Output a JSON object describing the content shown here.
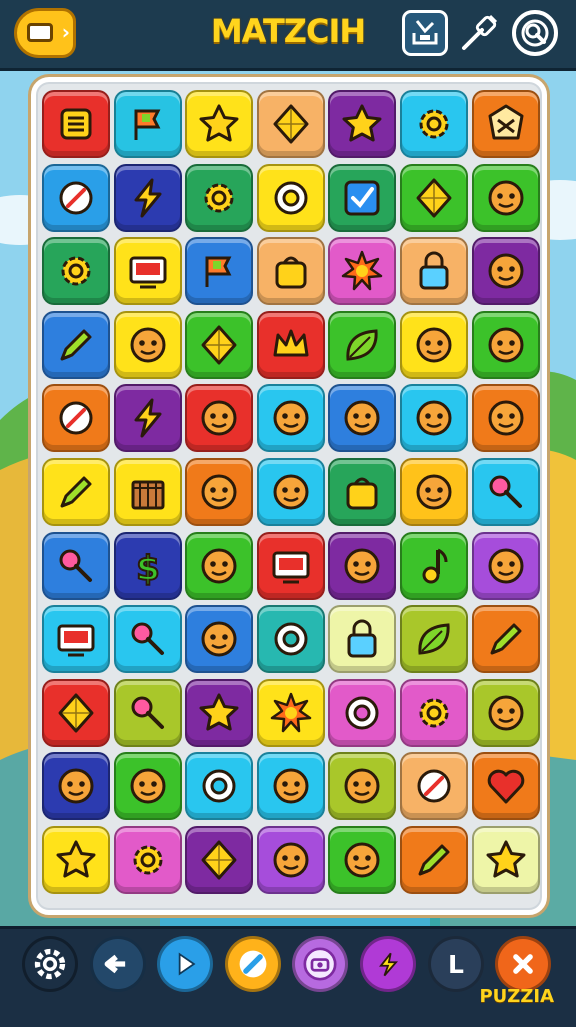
{
  "header": {
    "title": "MATZCIH"
  },
  "brand": "PUZZIA",
  "toolbar": {
    "menu_icon": "menu-icon",
    "tools": [
      "download-tray-icon",
      "wand-icon",
      "search-refresh-icon"
    ]
  },
  "board": {
    "rows": 11,
    "cols": 7,
    "tiles": [
      [
        {
          "c": "#e8302b",
          "i": "menu"
        },
        {
          "c": "#27c3e3",
          "i": "flag"
        },
        {
          "c": "#ffe21a",
          "i": "star"
        },
        {
          "c": "#f7b266",
          "i": "gem"
        },
        {
          "c": "#7e2aa1",
          "i": "star"
        },
        {
          "c": "#29c6ef",
          "i": "gear"
        },
        {
          "c": "#f07a1a",
          "i": "badge"
        }
      ],
      [
        {
          "c": "#2a9fe8",
          "i": "compass"
        },
        {
          "c": "#2c3bb0",
          "i": "bolt"
        },
        {
          "c": "#27a55a",
          "i": "gear"
        },
        {
          "c": "#ffe21a",
          "i": "ring"
        },
        {
          "c": "#27a55a",
          "i": "check"
        },
        {
          "c": "#3cc22a",
          "i": "gem"
        },
        {
          "c": "#3cc22a",
          "i": "face"
        }
      ],
      [
        {
          "c": "#27a55a",
          "i": "gear"
        },
        {
          "c": "#ffe21a",
          "i": "screen"
        },
        {
          "c": "#2e7fde",
          "i": "flag"
        },
        {
          "c": "#f7b266",
          "i": "bag"
        },
        {
          "c": "#e25ac9",
          "i": "sun"
        },
        {
          "c": "#f7b266",
          "i": "lock"
        },
        {
          "c": "#7e2aa1",
          "i": "face"
        }
      ],
      [
        {
          "c": "#2e7fde",
          "i": "pen"
        },
        {
          "c": "#ffe21a",
          "i": "face"
        },
        {
          "c": "#3cc22a",
          "i": "gem"
        },
        {
          "c": "#e8302b",
          "i": "crown"
        },
        {
          "c": "#3cc22a",
          "i": "leaf"
        },
        {
          "c": "#ffe21a",
          "i": "face"
        },
        {
          "c": "#3cc22a",
          "i": "face"
        }
      ],
      [
        {
          "c": "#f07a1a",
          "i": "compass"
        },
        {
          "c": "#7e2aa1",
          "i": "bolt"
        },
        {
          "c": "#e8302b",
          "i": "face"
        },
        {
          "c": "#29c6ef",
          "i": "face"
        },
        {
          "c": "#2e7fde",
          "i": "face"
        },
        {
          "c": "#29c6ef",
          "i": "face"
        },
        {
          "c": "#f07a1a",
          "i": "face"
        }
      ],
      [
        {
          "c": "#ffe21a",
          "i": "pen"
        },
        {
          "c": "#ffe21a",
          "i": "crate"
        },
        {
          "c": "#f07a1a",
          "i": "face"
        },
        {
          "c": "#29c6ef",
          "i": "face"
        },
        {
          "c": "#27a55a",
          "i": "bag"
        },
        {
          "c": "#ffc21a",
          "i": "face"
        },
        {
          "c": "#29c6ef",
          "i": "pin"
        }
      ],
      [
        {
          "c": "#2e7fde",
          "i": "pin"
        },
        {
          "c": "#2c3bb0",
          "i": "dollar"
        },
        {
          "c": "#3cc22a",
          "i": "face"
        },
        {
          "c": "#e8302b",
          "i": "screen"
        },
        {
          "c": "#7e2aa1",
          "i": "face"
        },
        {
          "c": "#3cc22a",
          "i": "note"
        },
        {
          "c": "#a64ddb",
          "i": "face"
        }
      ],
      [
        {
          "c": "#29c6ef",
          "i": "screen"
        },
        {
          "c": "#29c6ef",
          "i": "pin"
        },
        {
          "c": "#2e7fde",
          "i": "face"
        },
        {
          "c": "#27b8b0",
          "i": "ring"
        },
        {
          "c": "#eef5a8",
          "i": "lock"
        },
        {
          "c": "#a9c72a",
          "i": "leaf"
        },
        {
          "c": "#f07a1a",
          "i": "pen"
        }
      ],
      [
        {
          "c": "#e8302b",
          "i": "gem"
        },
        {
          "c": "#a9c72a",
          "i": "pin"
        },
        {
          "c": "#7e2aa1",
          "i": "star"
        },
        {
          "c": "#ffe21a",
          "i": "sun"
        },
        {
          "c": "#e25ac9",
          "i": "ring"
        },
        {
          "c": "#e25ac9",
          "i": "gear"
        },
        {
          "c": "#a9c72a",
          "i": "face"
        }
      ],
      [
        {
          "c": "#2c3bb0",
          "i": "face"
        },
        {
          "c": "#3cc22a",
          "i": "face"
        },
        {
          "c": "#29c6ef",
          "i": "ring"
        },
        {
          "c": "#29c6ef",
          "i": "face"
        },
        {
          "c": "#a9c72a",
          "i": "face"
        },
        {
          "c": "#f7b266",
          "i": "compass"
        },
        {
          "c": "#f07a1a",
          "i": "heart"
        }
      ],
      [
        {
          "c": "#ffe21a",
          "i": "star"
        },
        {
          "c": "#e25ac9",
          "i": "gear"
        },
        {
          "c": "#7e2aa1",
          "i": "gem"
        },
        {
          "c": "#a64ddb",
          "i": "face"
        },
        {
          "c": "#3cc22a",
          "i": "face"
        },
        {
          "c": "#f07a1a",
          "i": "pen"
        },
        {
          "c": "#eef5a8",
          "i": "star"
        }
      ]
    ]
  },
  "bottom_buttons": [
    {
      "name": "settings-icon",
      "bg": "#1b2f44",
      "fg": "#ffffff"
    },
    {
      "name": "back-arrow-icon",
      "bg": "#23486a",
      "fg": "#ffffff"
    },
    {
      "name": "play-icon",
      "bg": "#2a9fe8",
      "fg": "#ffffff"
    },
    {
      "name": "feather-icon",
      "bg": "#ffb21a",
      "fg": "#2a9fe8"
    },
    {
      "name": "camera-icon",
      "bg": "#b76ae0",
      "fg": "#ffffff"
    },
    {
      "name": "bolt-icon",
      "bg": "#b03ad6",
      "fg": "#ffe21a"
    },
    {
      "name": "letter-l-icon",
      "bg": "#2a3f5a",
      "fg": "#ffffff"
    },
    {
      "name": "close-icon",
      "bg": "#f0661a",
      "fg": "#ffffff"
    }
  ]
}
